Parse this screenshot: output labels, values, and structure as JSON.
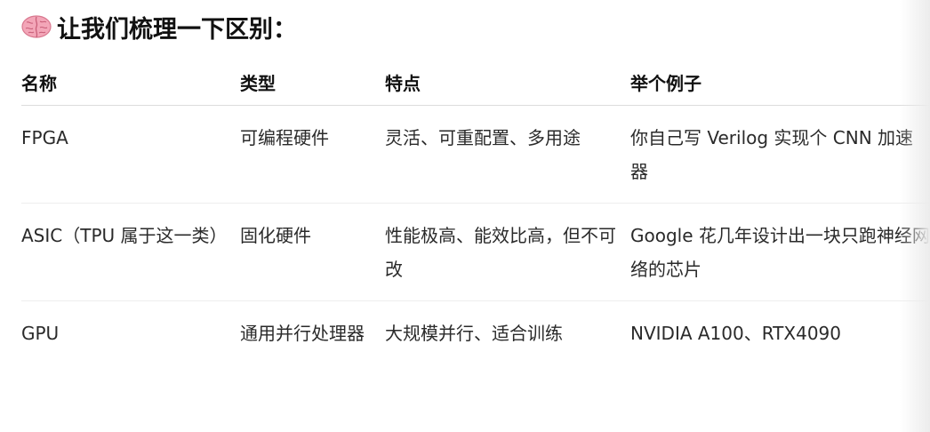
{
  "heading": {
    "icon": "brain-icon",
    "text": "让我们梳理一下区别："
  },
  "table": {
    "headers": [
      "名称",
      "类型",
      "特点",
      "举个例子"
    ],
    "rows": [
      [
        "FPGA",
        "可编程硬件",
        "灵活、可重配置、多用途",
        "你自己写 Verilog 实现个 CNN 加速器"
      ],
      [
        "ASIC（TPU 属于这一类）",
        "固化硬件",
        "性能极高、能效比高，但不可改",
        "Google 花几年设计出一块只跑神经网络的芯片"
      ],
      [
        "GPU",
        "通用并行处理器",
        "大规模并行、适合训练",
        "NVIDIA A100、RTX4090"
      ]
    ]
  },
  "colors": {
    "text": "#2a2a2a",
    "heading": "#111111",
    "divider": "#dcdcdc",
    "brain": "#f3a6b8"
  }
}
